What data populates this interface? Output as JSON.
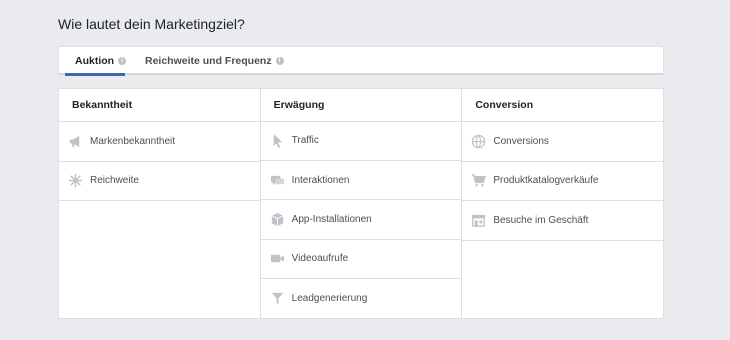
{
  "heading": "Wie lautet dein Marketingziel?",
  "tabs": [
    {
      "label": "Auktion",
      "active": true
    },
    {
      "label": "Reichweite und Frequenz",
      "active": false
    }
  ],
  "columns": [
    {
      "title": "Bekanntheit",
      "items": [
        {
          "label": "Markenbekanntheit",
          "icon": "megaphone-icon"
        },
        {
          "label": "Reichweite",
          "icon": "snowflake-icon"
        }
      ]
    },
    {
      "title": "Erwägung",
      "items": [
        {
          "label": "Traffic",
          "icon": "cursor-icon"
        },
        {
          "label": "Interaktionen",
          "icon": "chat-bubbles-icon"
        },
        {
          "label": "App-Installationen",
          "icon": "box-icon"
        },
        {
          "label": "Videoaufrufe",
          "icon": "video-camera-icon"
        },
        {
          "label": "Leadgenerierung",
          "icon": "funnel-icon"
        }
      ]
    },
    {
      "title": "Conversion",
      "items": [
        {
          "label": "Conversions",
          "icon": "globe-icon"
        },
        {
          "label": "Produktkatalogverkäufe",
          "icon": "cart-icon"
        },
        {
          "label": "Besuche im Geschäft",
          "icon": "store-icon"
        }
      ]
    }
  ],
  "colors": {
    "accent": "#4267b2",
    "icon": "#bec3c9"
  }
}
